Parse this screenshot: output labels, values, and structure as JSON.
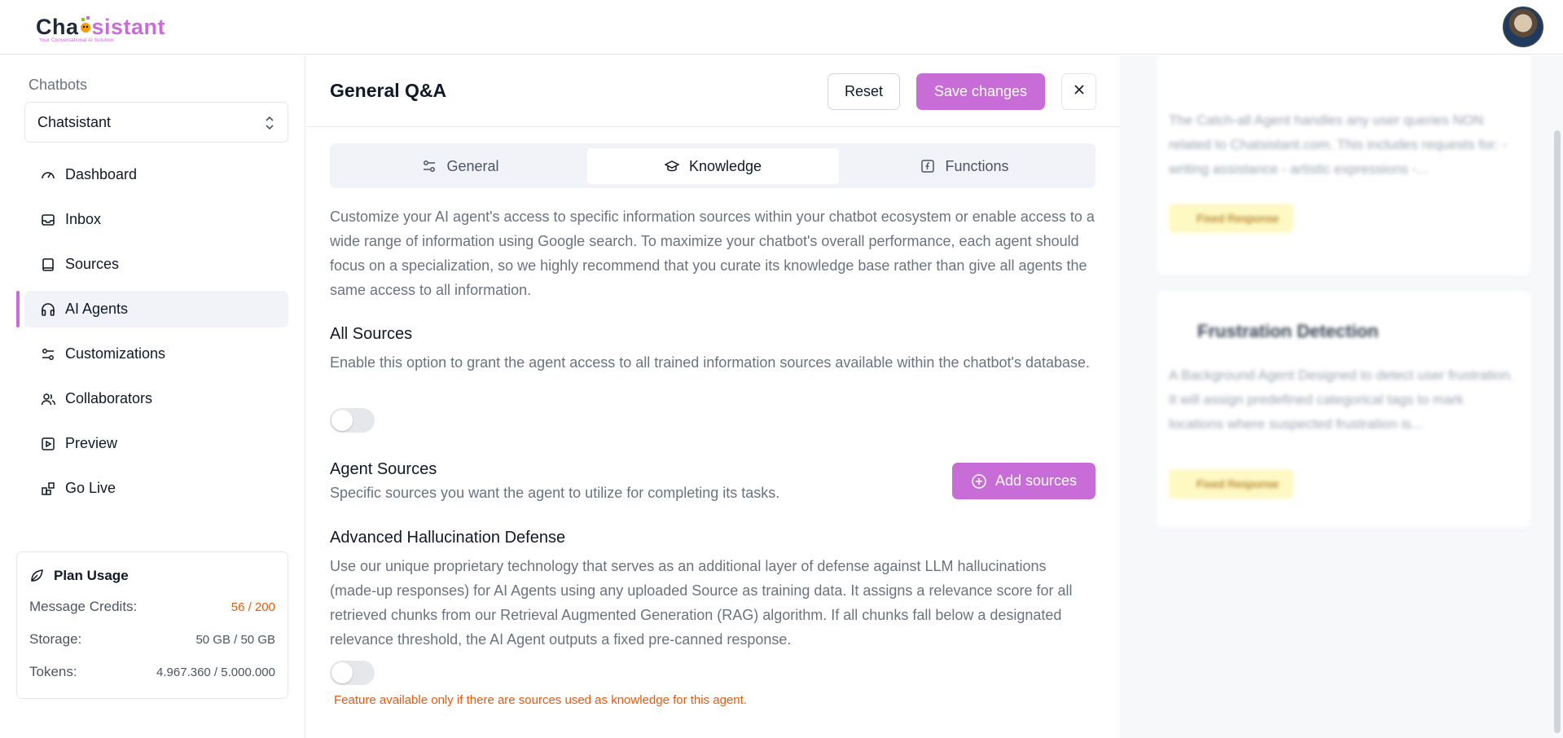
{
  "brand": {
    "logo_pre": "Cha",
    "logo_post": "sistant",
    "tagline": "Your Conversational AI Solution"
  },
  "sidebar": {
    "label": "Chatbots",
    "selected_bot": "Chatsistant",
    "items": [
      {
        "label": "Dashboard",
        "icon": "gauge-icon"
      },
      {
        "label": "Inbox",
        "icon": "inbox-icon"
      },
      {
        "label": "Sources",
        "icon": "book-icon"
      },
      {
        "label": "AI Agents",
        "icon": "headphones-icon",
        "active": true
      },
      {
        "label": "Customizations",
        "icon": "sliders-icon"
      },
      {
        "label": "Collaborators",
        "icon": "users-icon"
      },
      {
        "label": "Preview",
        "icon": "play-icon"
      },
      {
        "label": "Go Live",
        "icon": "rocket-icon"
      }
    ],
    "plan": {
      "title": "Plan Usage",
      "rows": [
        {
          "label": "Message Credits:",
          "value": "56 / 200"
        },
        {
          "label": "Storage:",
          "value": "50 GB / 50 GB"
        },
        {
          "label": "Tokens:",
          "value": "4.967.360 / 5.000.000"
        }
      ]
    }
  },
  "main": {
    "title": "General Q&A",
    "reset_label": "Reset",
    "save_label": "Save changes",
    "tabs": [
      {
        "label": "General"
      },
      {
        "label": "Knowledge",
        "active": true
      },
      {
        "label": "Functions"
      }
    ],
    "intro": "Customize your AI agent's access to specific information sources within your chatbot ecosystem or enable access to a wide range of information using Google search. To maximize your chatbot's overall performance, each agent should focus on a specialization, so we highly recommend that you curate its knowledge base rather than give all agents the same access to all information.",
    "all_sources": {
      "title": "All Sources",
      "desc": "Enable this option to grant the agent access to all trained information sources available within the chatbot's database.",
      "enabled": false
    },
    "agent_sources": {
      "title": "Agent Sources",
      "desc": "Specific sources you want the agent to utilize for completing its tasks.",
      "add_label": "Add sources"
    },
    "hallucination": {
      "title": "Advanced Hallucination Defense",
      "desc": "Use our unique proprietary technology that serves as an additional layer of defense against LLM hallucinations (made-up responses) for AI Agents using any uploaded Source as training data. It assigns a relevance score for all retrieved chunks from our Retrieval Augmented Generation (RAG) algorithm. If all chunks fall below a designated relevance threshold, the AI Agent outputs a fixed pre-canned response.",
      "enabled": false,
      "warning": "Feature available only if there are sources used as knowledge for this agent."
    }
  },
  "background_panel": {
    "card1_desc": "The Catch-all Agent handles any user queries NON related to Chatsistant.com. This includes requests for: - writing assistance - artistic expressions -...",
    "card1_badge": "Fixed Response",
    "card2_title": "Frustration Detection",
    "card2_desc": "A Background Agent Designed to detect user frustration. It will assign predefined categorical tags to mark locations where suspected frustration is...",
    "card2_badge": "Fixed Response"
  },
  "colors": {
    "accent": "#c86dd7",
    "warning": "#ea580c",
    "active_bg": "#f1f3f8"
  }
}
